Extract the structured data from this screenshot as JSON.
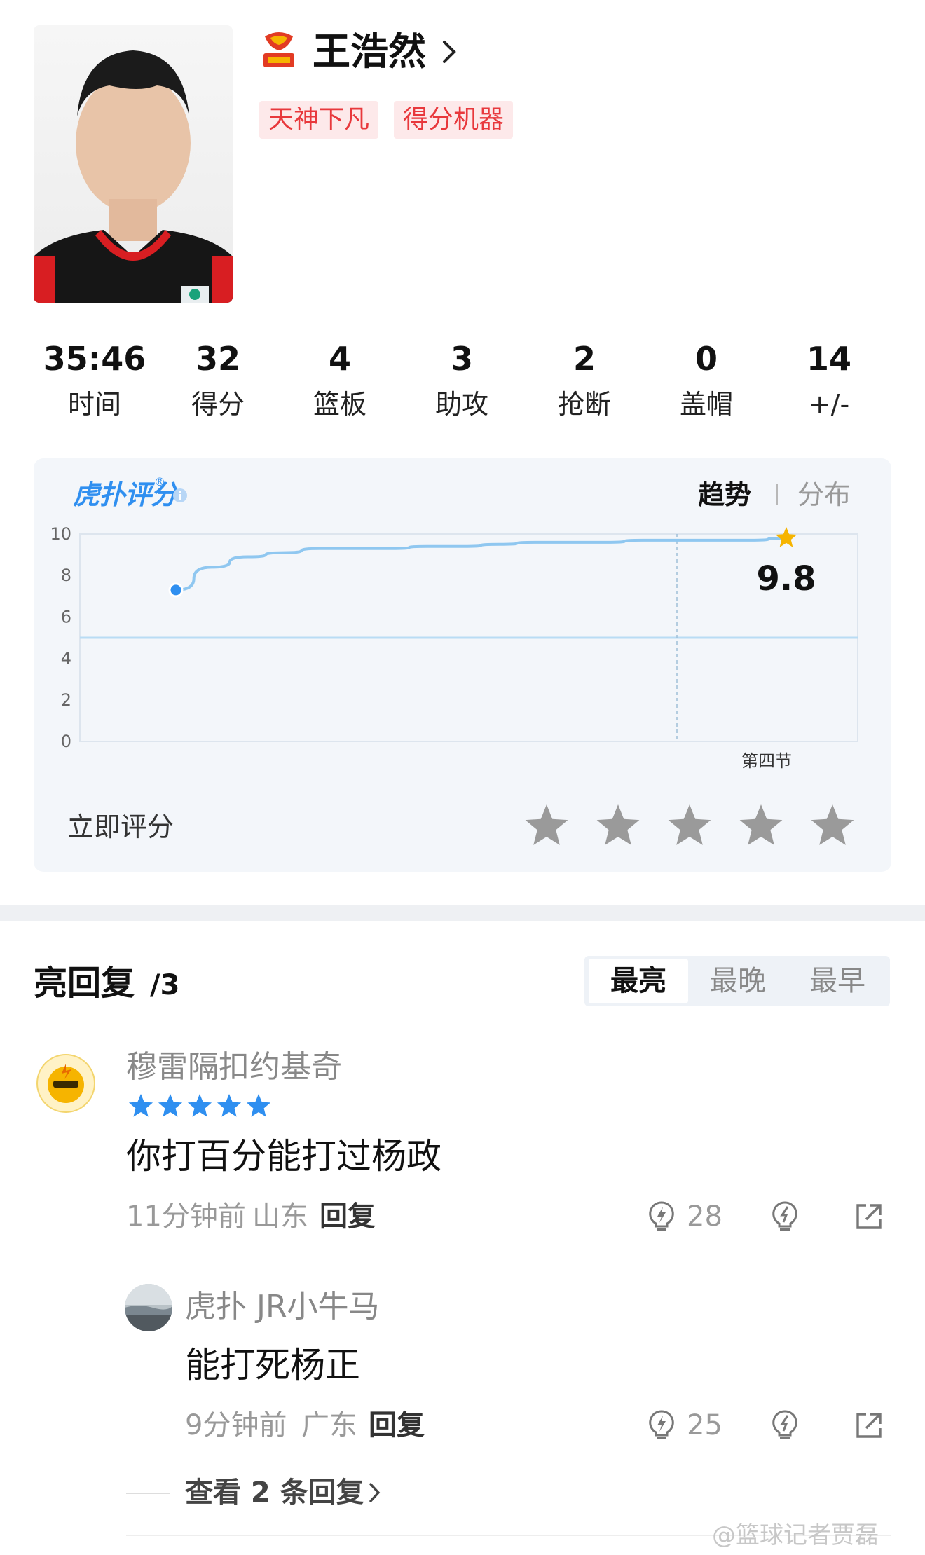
{
  "player": {
    "name": "王浩然",
    "tags": [
      "天神下凡",
      "得分机器"
    ]
  },
  "stats": [
    {
      "value": "35:46",
      "label": "时间"
    },
    {
      "value": "32",
      "label": "得分"
    },
    {
      "value": "4",
      "label": "篮板"
    },
    {
      "value": "3",
      "label": "助攻"
    },
    {
      "value": "2",
      "label": "抢断"
    },
    {
      "value": "0",
      "label": "盖帽"
    },
    {
      "value": "14",
      "label": "+/-"
    }
  ],
  "rating": {
    "brand": "虎扑评分",
    "brand_mark": "®",
    "tabs": {
      "trend": "趋势",
      "distribution": "分布"
    },
    "current_score": "9.8",
    "rate_now_label": "立即评分",
    "stars_count": 5
  },
  "chart_data": {
    "type": "line",
    "ylim": [
      0,
      10
    ],
    "yticks": [
      "10",
      "8",
      "6",
      "4",
      "2",
      "0"
    ],
    "x_annotation": "第四节",
    "series": [
      {
        "values": [
          7.3,
          8.4,
          8.9,
          9.1,
          9.3,
          9.3,
          9.3,
          9.4,
          9.4,
          9.5,
          9.6,
          9.6,
          9.6,
          9.7,
          9.7,
          9.7,
          9.7,
          9.8
        ]
      }
    ],
    "reference_line": 5,
    "colors": {
      "line": "#8fc7f0",
      "marker": "#2f8ff0",
      "star": "#f6b400"
    }
  },
  "replies": {
    "title": "亮回复",
    "count": "/3",
    "sort_options": [
      "最亮",
      "最晚",
      "最早"
    ],
    "active_sort": 0,
    "items": [
      {
        "user": "穆雷隔扣约基奇",
        "user_stars": 5,
        "text": "你打百分能打过杨政",
        "time": "11分钟前",
        "location": "山东",
        "reply_label": "回复",
        "likes": "28"
      },
      {
        "user": "虎扑 JR小牛马",
        "text": "能打死杨正",
        "time": "9分钟前",
        "location": "广东",
        "reply_label": "回复",
        "likes": "25"
      }
    ],
    "view_more": "查看 2 条回复",
    "watermark": "@篮球记者贾磊"
  }
}
